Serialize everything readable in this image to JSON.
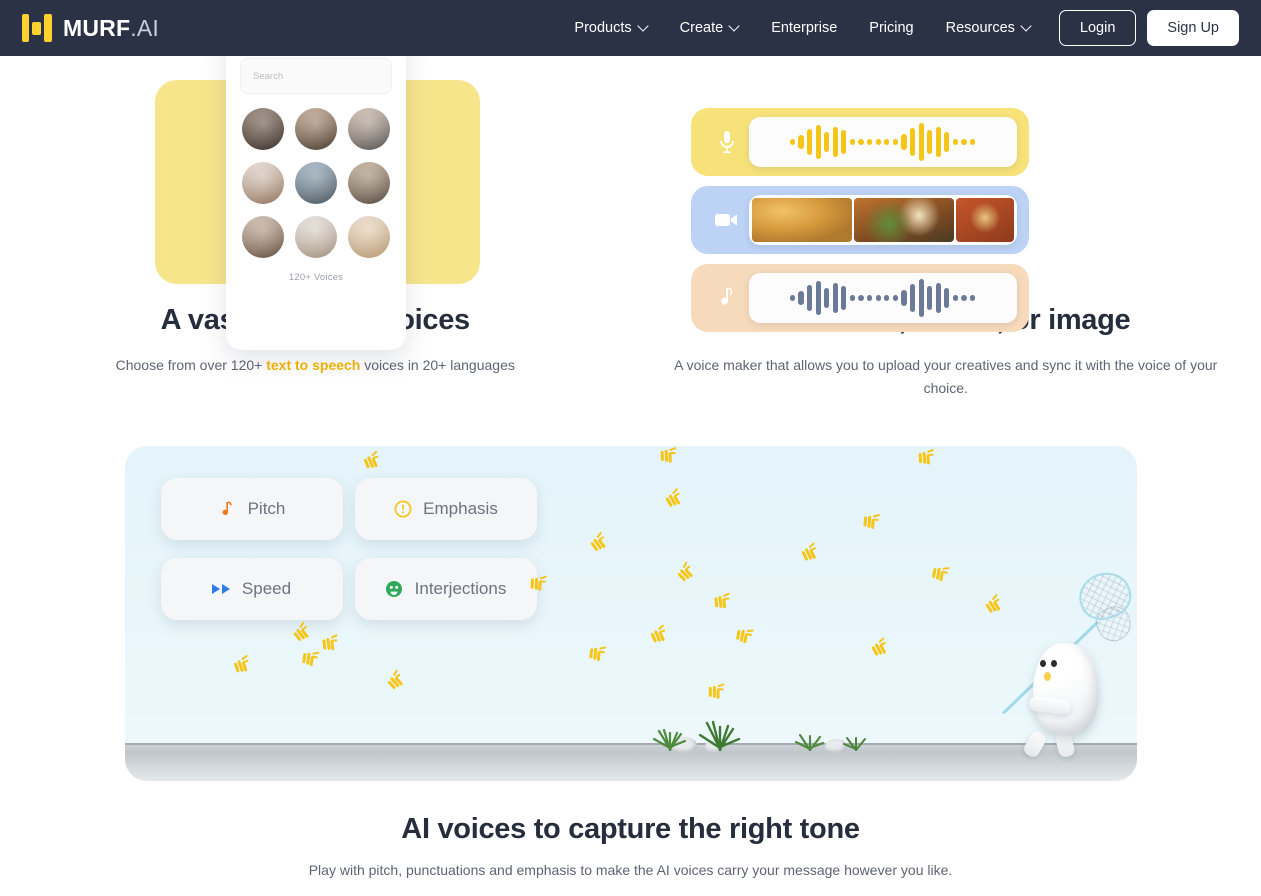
{
  "header": {
    "logo": {
      "name": "MURF",
      "suffix": ".AI"
    },
    "nav": [
      {
        "label": "Products",
        "has_dropdown": true
      },
      {
        "label": "Create",
        "has_dropdown": true
      },
      {
        "label": "Enterprise",
        "has_dropdown": false
      },
      {
        "label": "Pricing",
        "has_dropdown": false
      },
      {
        "label": "Resources",
        "has_dropdown": true
      }
    ],
    "login_label": "Login",
    "signup_label": "Sign Up",
    "bg_color": "#2b3245",
    "accent_color": "#ffd12e"
  },
  "features": {
    "voices": {
      "heading": "A vast library of voices",
      "body_prefix": "Choose from over 120+ ",
      "body_link": "text to speech",
      "body_suffix": " voices in 20+ languages",
      "card": {
        "search_placeholder": "Search",
        "voices_count_label": "120+ Voices",
        "avatar_count": 9,
        "slab_color": "#f7e58c"
      }
    },
    "media": {
      "heading": "Add video, music, or image",
      "body": "A voice maker that allows you to upload your creatives and sync it with the voice of your choice.",
      "tracks": [
        {
          "icon": "microphone-icon",
          "color": "#f7e27a",
          "content": "waveform",
          "wave_color": "#f5c518"
        },
        {
          "icon": "video-camera-icon",
          "color": "#bcd3f5",
          "content": "thumbnails"
        },
        {
          "icon": "music-note-icon",
          "color": "#f7d9bb",
          "content": "waveform",
          "wave_color": "#6b7a99"
        }
      ]
    }
  },
  "tone_panel": {
    "heading": "AI voices to capture the right tone",
    "body": "Play with pitch, punctuations and emphasis to make the AI voices carry your message however you like.",
    "bg_color": "#e6f5f9",
    "pills": [
      {
        "label": "Pitch",
        "icon": "music-note-icon",
        "icon_color": "#f07818"
      },
      {
        "label": "Emphasis",
        "icon": "exclamation-circle-icon",
        "icon_color": "#f5c518"
      },
      {
        "label": "Speed",
        "icon": "fast-forward-icon",
        "icon_color": "#2f7ce8"
      },
      {
        "label": "Interjections",
        "icon": "smiley-face-icon",
        "icon_color": "#2eaa5a"
      }
    ],
    "illustration": {
      "mascot": "blob-character-with-net",
      "flying_marks": "yellow-m-butterflies"
    }
  },
  "waveforms": {
    "bars": [
      6,
      14,
      26,
      34,
      20,
      30,
      24,
      6,
      6,
      6,
      6,
      6,
      6,
      16,
      28,
      38,
      24,
      30,
      20,
      6,
      6,
      6
    ]
  }
}
